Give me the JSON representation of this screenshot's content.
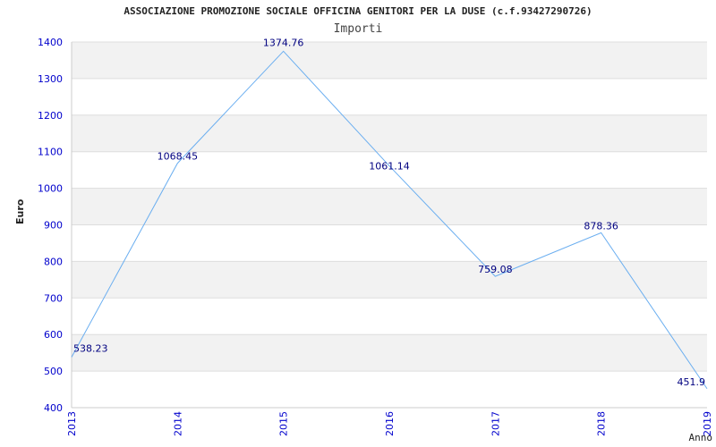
{
  "chart_data": {
    "type": "line",
    "title": "ASSOCIAZIONE PROMOZIONE SOCIALE OFFICINA GENITORI PER LA DUSE (c.f.93427290726)",
    "subtitle": "Importi",
    "xlabel": "Anno",
    "ylabel": "Euro",
    "categories": [
      "2013",
      "2014",
      "2015",
      "2016",
      "2017",
      "2018",
      "2019"
    ],
    "series": [
      {
        "values": [
          538.23,
          1068.45,
          1374.76,
          1061.14,
          759.08,
          878.36,
          451.9
        ],
        "labels": [
          "538.23",
          "1068.45",
          "1374.76",
          "1061.14",
          "759.08",
          "878.36",
          "451.9"
        ]
      }
    ],
    "ylim": [
      400,
      1400
    ],
    "yticks": [
      400,
      500,
      600,
      700,
      800,
      900,
      1000,
      1100,
      1200,
      1300,
      1400
    ],
    "grid": true,
    "colors": {
      "line": "#6aaef0",
      "tick_text": "#0000cc",
      "data_label": "#000080",
      "band": "#f2f2f2",
      "grid": "#dddddd"
    }
  }
}
